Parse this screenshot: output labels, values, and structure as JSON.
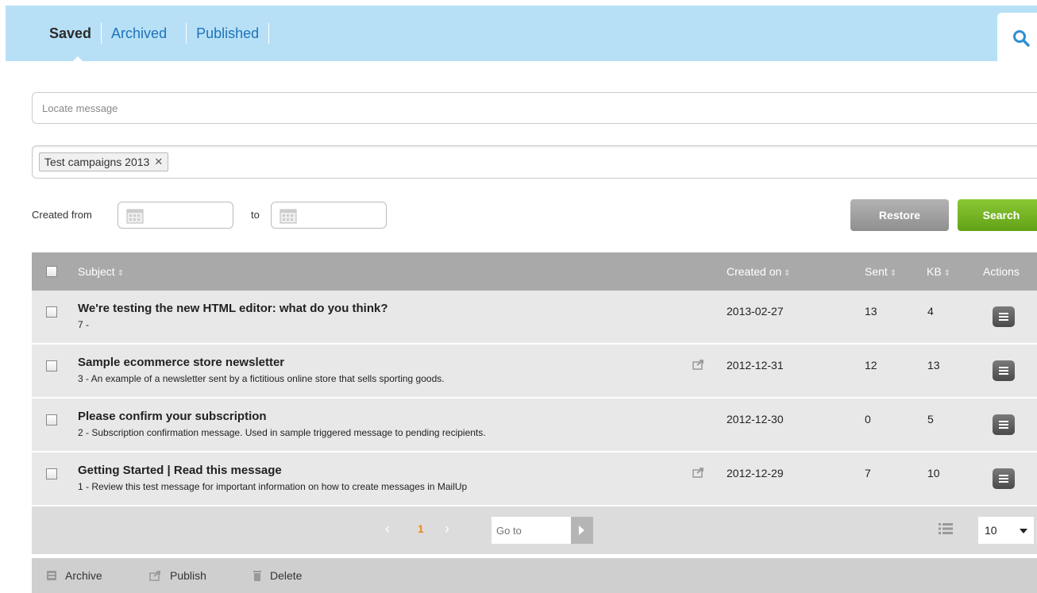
{
  "tabs": [
    {
      "label": "Saved",
      "active": true
    },
    {
      "label": "Archived",
      "active": false
    },
    {
      "label": "Published",
      "active": false
    }
  ],
  "search_placeholder": "Locate message",
  "filter_tag": "Test campaigns 2013",
  "date_filter": {
    "from_label": "Created from",
    "to_label": "to"
  },
  "buttons": {
    "restore": "Restore",
    "search": "Search"
  },
  "table": {
    "headers": {
      "subject": "Subject",
      "created_on": "Created on",
      "sent": "Sent",
      "kb": "KB",
      "actions": "Actions"
    },
    "rows": [
      {
        "subject": "We're testing the new HTML editor: what do you think?",
        "description": "7 -",
        "published": false,
        "created_on": "2013-02-27",
        "sent": "13",
        "kb": "4"
      },
      {
        "subject": "Sample ecommerce store newsletter",
        "description": "3 - An example of a newsletter sent by a fictitious online store that sells sporting goods.",
        "published": true,
        "created_on": "2012-12-31",
        "sent": "12",
        "kb": "13"
      },
      {
        "subject": "Please confirm your subscription",
        "description": "2 - Subscription confirmation message. Used in sample triggered message to pending recipients.",
        "published": false,
        "created_on": "2012-12-30",
        "sent": "0",
        "kb": "5"
      },
      {
        "subject": "Getting Started | Read this message",
        "description": "1 - Review this test message for important information on how to create messages in MailUp",
        "published": true,
        "created_on": "2012-12-29",
        "sent": "7",
        "kb": "10"
      }
    ]
  },
  "pagination": {
    "current_page": "1",
    "goto_placeholder": "Go to",
    "per_page": "10"
  },
  "bulk_actions": {
    "archive": "Archive",
    "publish": "Publish",
    "delete": "Delete"
  },
  "colors": {
    "tab_bar": "#b7e0f7",
    "link": "#1f73b7",
    "search_button": "#6aad1f",
    "restore_button": "#9e9e9e",
    "page_active": "#e88a1a"
  }
}
